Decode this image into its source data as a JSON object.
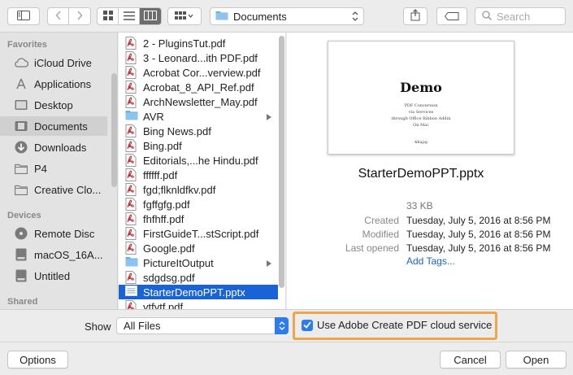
{
  "toolbar": {
    "path_label": "Documents",
    "search_placeholder": "Search"
  },
  "sidebar": {
    "favorites_header": "Favorites",
    "favorites": [
      {
        "label": "iCloud Drive",
        "icon": "cloud-icon"
      },
      {
        "label": "Applications",
        "icon": "applications-icon"
      },
      {
        "label": "Desktop",
        "icon": "desktop-icon"
      },
      {
        "label": "Documents",
        "icon": "documents-icon",
        "selected": true
      },
      {
        "label": "Downloads",
        "icon": "downloads-icon"
      },
      {
        "label": "P4",
        "icon": "folder-icon"
      },
      {
        "label": "Creative Clo...",
        "icon": "folder-icon"
      }
    ],
    "devices_header": "Devices",
    "devices": [
      {
        "label": "Remote Disc",
        "icon": "disc-icon"
      },
      {
        "label": "macOS_16A...",
        "icon": "drive-icon"
      },
      {
        "label": "Untitled",
        "icon": "drive-icon"
      }
    ],
    "shared_header": "Shared"
  },
  "files": [
    {
      "name": "2 - PluginsTut.pdf",
      "type": "pdf"
    },
    {
      "name": "3 - Leonard...ith PDF.pdf",
      "type": "pdf"
    },
    {
      "name": "Acrobat Cor...verview.pdf",
      "type": "pdf"
    },
    {
      "name": "Acrobat_8_API_Ref.pdf",
      "type": "pdf"
    },
    {
      "name": "ArchNewsletter_May.pdf",
      "type": "pdf"
    },
    {
      "name": "AVR",
      "type": "folder"
    },
    {
      "name": "Bing News.pdf",
      "type": "pdf"
    },
    {
      "name": "Bing.pdf",
      "type": "pdf"
    },
    {
      "name": "Editorials,...he Hindu.pdf",
      "type": "pdf"
    },
    {
      "name": "ffffff.pdf",
      "type": "pdf"
    },
    {
      "name": "fgd;flknldfkv.pdf",
      "type": "pdf"
    },
    {
      "name": "fgffgfg.pdf",
      "type": "pdf"
    },
    {
      "name": "fhfhff.pdf",
      "type": "pdf"
    },
    {
      "name": "FirstGuideT...stScript.pdf",
      "type": "pdf"
    },
    {
      "name": "Google.pdf",
      "type": "pdf"
    },
    {
      "name": "PictureItOutput",
      "type": "folder"
    },
    {
      "name": "sdgdsg.pdf",
      "type": "pdf"
    },
    {
      "name": "StarterDemoPPT.pptx",
      "type": "pptx",
      "selected": true
    },
    {
      "name": "ytfytf.pdf",
      "type": "pdf"
    }
  ],
  "preview": {
    "thumb_title": "Demo",
    "thumb_lines": [
      "PDF Conversion",
      "via Services",
      "through Office Ribbon Addin",
      "On Mac"
    ],
    "thumb_footer": "-khajaj-",
    "file_name": "StarterDemoPPT.pptx",
    "size": "33 KB",
    "created_label": "Created",
    "created_value": "Tuesday, July 5, 2016 at 8:56 PM",
    "modified_label": "Modified",
    "modified_value": "Tuesday, July 5, 2016 at 8:56 PM",
    "last_opened_label": "Last opened",
    "last_opened_value": "Tuesday, July 5, 2016 at 8:56 PM",
    "add_tags": "Add Tags..."
  },
  "bottom": {
    "show_label": "Show",
    "show_value": "All Files",
    "checkbox_label": "Use Adobe Create PDF cloud service",
    "checkbox_checked": true,
    "options_label": "Options",
    "cancel_label": "Cancel",
    "open_label": "Open"
  },
  "colors": {
    "accent": "#1a63d6",
    "highlight": "#f0a54a",
    "pdf_red": "#c8262c",
    "folder_blue": "#6bb0e8"
  }
}
